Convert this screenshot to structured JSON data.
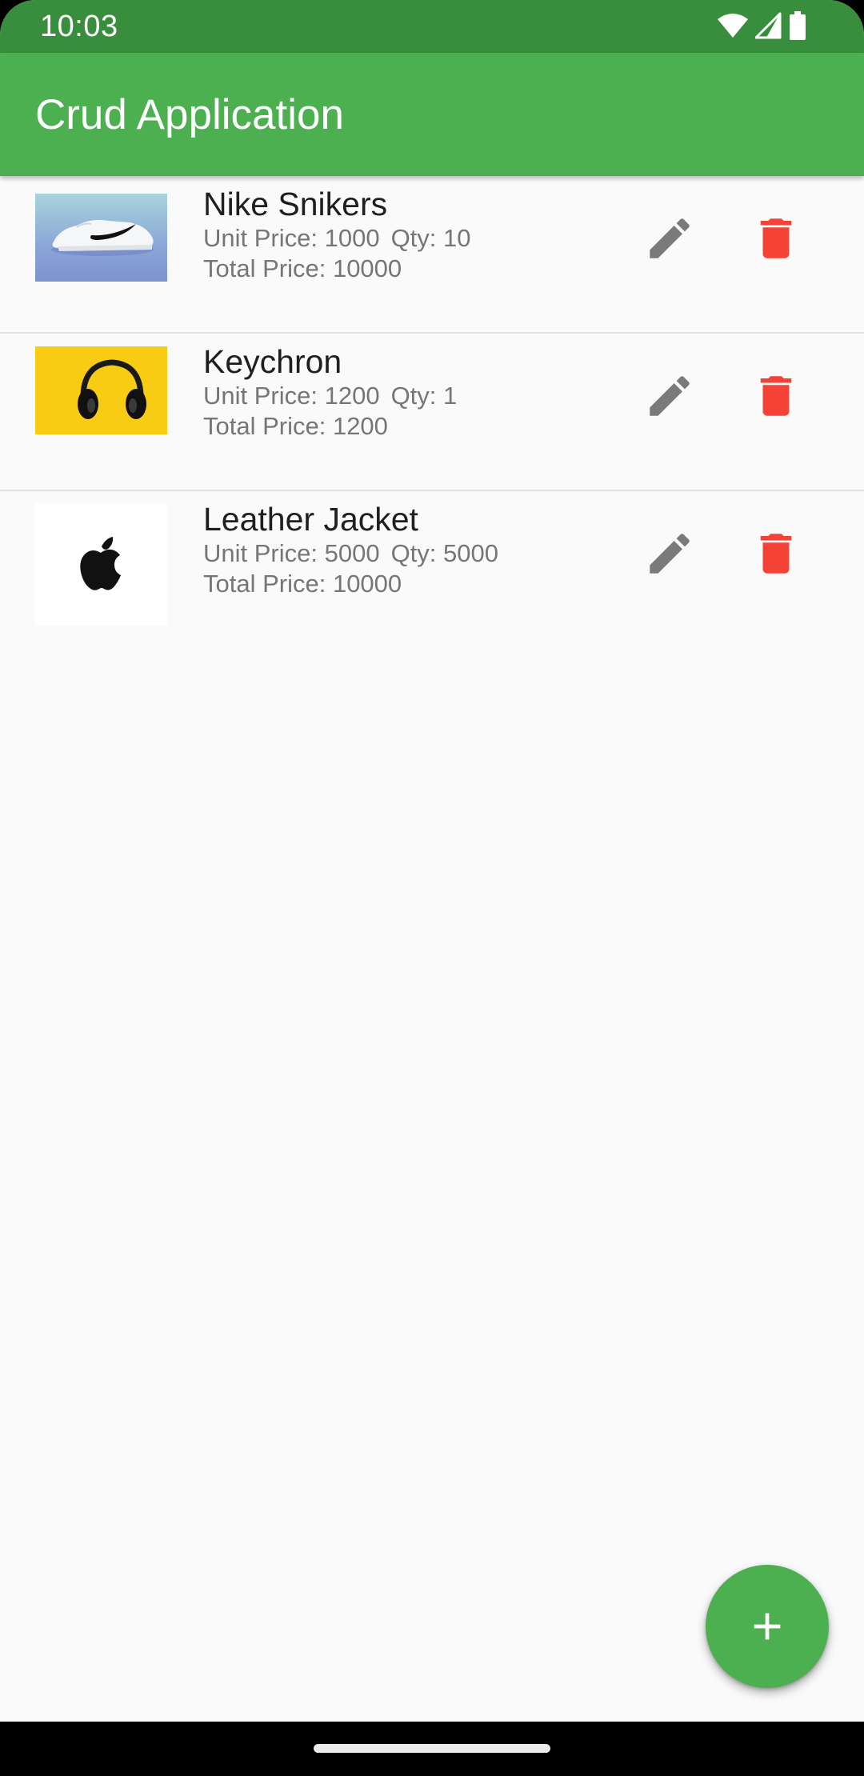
{
  "status_bar": {
    "time": "10:03"
  },
  "app_bar": {
    "title": "Crud Application"
  },
  "products": [
    {
      "name": "Nike Snikers",
      "unit_price_text": "Unit Price: 1000",
      "qty_text": "Qty: 10",
      "total_price_text": "Total Price: 10000",
      "image": "sneaker-photo"
    },
    {
      "name": "Keychron",
      "unit_price_text": "Unit Price: 1200",
      "qty_text": "Qty: 1",
      "total_price_text": "Total Price: 1200",
      "image": "headphones-photo"
    },
    {
      "name": "Leather Jacket",
      "unit_price_text": "Unit Price: 5000",
      "qty_text": "Qty: 5000",
      "total_price_text": "Total Price: 10000",
      "image": "apple-logo"
    }
  ],
  "icons": {
    "edit": "pencil-icon",
    "delete": "trash-icon",
    "add": "plus-icon"
  },
  "colors": {
    "primary": "#4caf50",
    "primary_dark": "#388e3c",
    "edit_icon": "#7a7a7a",
    "delete_icon": "#f44336",
    "background": "#fafafa"
  }
}
